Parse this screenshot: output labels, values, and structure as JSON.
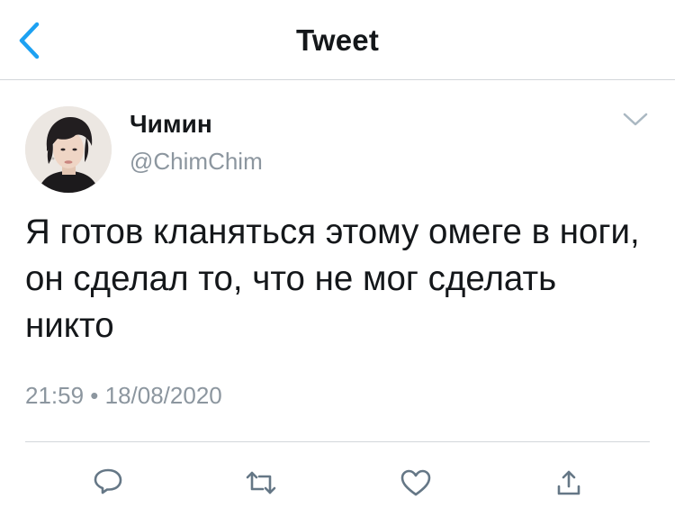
{
  "header": {
    "title": "Tweet",
    "back_icon": "chevron-left-icon"
  },
  "tweet": {
    "author": {
      "display_name": "Чимин",
      "handle": "@ChimChim"
    },
    "text": "Я готов кланяться этому омеге в ноги, он сделал то, что не мог сделать никто",
    "timestamp": "21:59 • 18/08/2020",
    "more_icon": "chevron-down-icon"
  },
  "actions": [
    {
      "name": "reply",
      "icon": "reply-icon"
    },
    {
      "name": "retweet",
      "icon": "retweet-icon"
    },
    {
      "name": "like",
      "icon": "heart-icon"
    },
    {
      "name": "share",
      "icon": "share-icon"
    }
  ],
  "colors": {
    "accent": "#1da1f2",
    "secondary_text": "#8c969f",
    "icon_gray": "#657786",
    "divider": "#d3d6da"
  }
}
